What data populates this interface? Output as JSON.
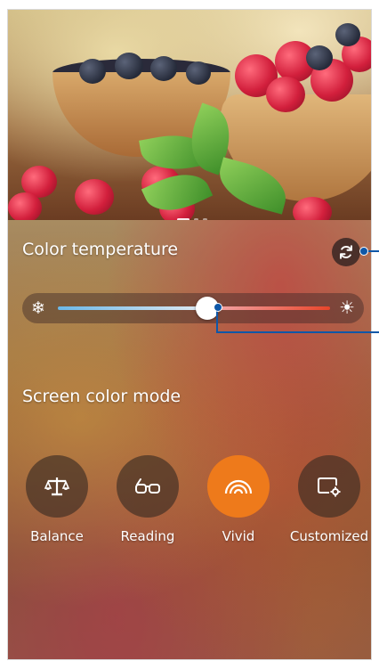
{
  "color_temperature": {
    "label": "Color temperature",
    "slider_value_percent": 55
  },
  "screen_color_mode": {
    "label": "Screen color mode",
    "modes": [
      {
        "label": "Balance",
        "icon": "scale-icon",
        "selected": false
      },
      {
        "label": "Reading",
        "icon": "glasses-icon",
        "selected": false
      },
      {
        "label": "Vivid",
        "icon": "rainbow-icon",
        "selected": true
      },
      {
        "label": "Customized",
        "icon": "custom-settings-icon",
        "selected": false
      }
    ]
  },
  "colors": {
    "accent": "#ee7a1b",
    "callout": "#0f57a7"
  }
}
